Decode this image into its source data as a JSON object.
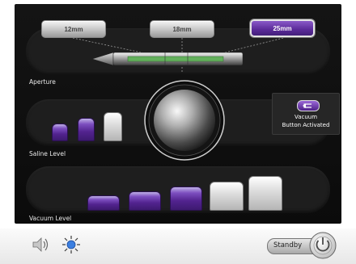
{
  "aperture": {
    "label": "Aperture",
    "options": [
      "12mm",
      "18mm",
      "25mm"
    ],
    "selected": "25mm"
  },
  "saline": {
    "label": "Saline Level",
    "total": 3,
    "filled": 2
  },
  "vacuum": {
    "label": "Vacuum Level",
    "total": 5,
    "filled": 3
  },
  "vacuum_status": {
    "line1": "Vacuum",
    "line2": "Button Activated"
  },
  "footer": {
    "standby_label": "Standby"
  },
  "colors": {
    "accent": "#5a2a98",
    "panel": "#111111",
    "track": "#1e1e1e"
  },
  "icons": [
    "speaker-icon",
    "brightness-icon",
    "power-icon",
    "vacuum-arrow-icon"
  ]
}
